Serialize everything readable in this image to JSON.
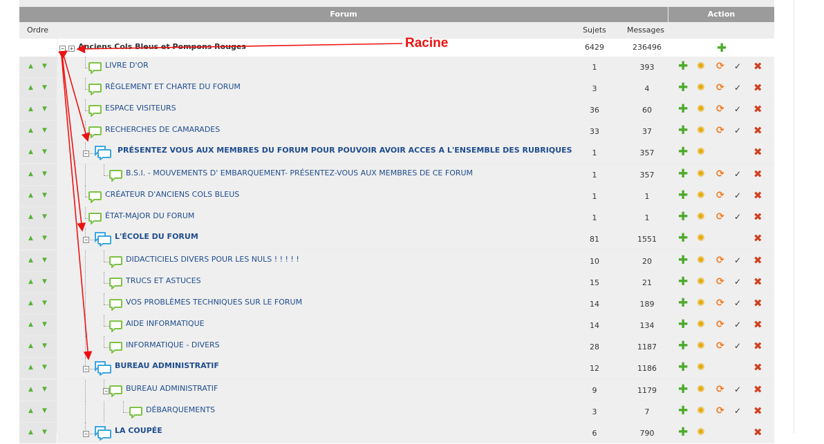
{
  "header": {
    "forum": "Forum",
    "action": "Action"
  },
  "columns": {
    "ordre": "Ordre",
    "sujets": "Sujets",
    "messages": "Messages"
  },
  "annotation": {
    "label": "Racine"
  },
  "icons": {
    "add": "add-plus-icon",
    "permissions": "permissions-gear-icon",
    "sync": "sync-icon",
    "prune": "prune-icon",
    "delete": "delete-x-icon",
    "bubble": "speech-bubble-icon",
    "bubble_double": "double-speech-bubble-icon"
  },
  "rows": [
    {
      "name": "Anciens Cols Bleus et Pompons Rouges",
      "sujets": "6429",
      "messages": "236496",
      "level": 0,
      "kind": "root"
    },
    {
      "name": "LIVRE D'OR",
      "sujets": "1",
      "messages": "393",
      "level": 1,
      "kind": "forum"
    },
    {
      "name": "RÈGLEMENT ET CHARTE DU FORUM",
      "sujets": "3",
      "messages": "4",
      "level": 1,
      "kind": "forum"
    },
    {
      "name": "ESPACE VISITEURS",
      "sujets": "36",
      "messages": "60",
      "level": 1,
      "kind": "forum"
    },
    {
      "name": "RECHERCHES DE CAMARADES",
      "sujets": "33",
      "messages": "37",
      "level": 1,
      "kind": "forum"
    },
    {
      "name": "PRÉSENTEZ VOUS AUX MEMBRES DU FORUM POUR POUVOIR AVOIR ACCES A L'ENSEMBLE DES RUBRIQUES",
      "sujets": "1",
      "messages": "357",
      "level": 1,
      "kind": "category"
    },
    {
      "name": "B.S.I. - MOUVEMENTS D' EMBARQUEMENT- PRÉSENTEZ-VOUS AUX MEMBRES DE CE FORUM",
      "sujets": "1",
      "messages": "357",
      "level": 2,
      "kind": "forum"
    },
    {
      "name": "CRÉATEUR D'ANCIENS COLS BLEUS",
      "sujets": "1",
      "messages": "1",
      "level": 1,
      "kind": "forum"
    },
    {
      "name": "ÉTAT-MAJOR DU FORUM",
      "sujets": "1",
      "messages": "1",
      "level": 1,
      "kind": "forum"
    },
    {
      "name": "L'ÉCOLE DU FORUM",
      "sujets": "81",
      "messages": "1551",
      "level": 1,
      "kind": "category"
    },
    {
      "name": "DIDACTICIELS DIVERS POUR LES NULS ! ! ! ! !",
      "sujets": "10",
      "messages": "20",
      "level": 2,
      "kind": "forum"
    },
    {
      "name": "TRUCS ET ASTUCES",
      "sujets": "15",
      "messages": "21",
      "level": 2,
      "kind": "forum"
    },
    {
      "name": "VOS PROBLÈMES TECHNIQUES SUR LE FORUM",
      "sujets": "14",
      "messages": "189",
      "level": 2,
      "kind": "forum"
    },
    {
      "name": "AIDE INFORMATIQUE",
      "sujets": "14",
      "messages": "134",
      "level": 2,
      "kind": "forum"
    },
    {
      "name": "INFORMATIQUE - DIVERS",
      "sujets": "28",
      "messages": "1187",
      "level": 2,
      "kind": "forum"
    },
    {
      "name": "BUREAU ADMINISTRATIF",
      "sujets": "12",
      "messages": "1186",
      "level": 1,
      "kind": "category"
    },
    {
      "name": "BUREAU ADMINISTRATIF",
      "sujets": "9",
      "messages": "1179",
      "level": 2,
      "kind": "subforum"
    },
    {
      "name": "DÉBARQUEMENTS",
      "sujets": "3",
      "messages": "7",
      "level": 3,
      "kind": "forum"
    },
    {
      "name": "LA COUPÉE",
      "sujets": "6",
      "messages": "790",
      "level": 1,
      "kind": "category"
    }
  ]
}
